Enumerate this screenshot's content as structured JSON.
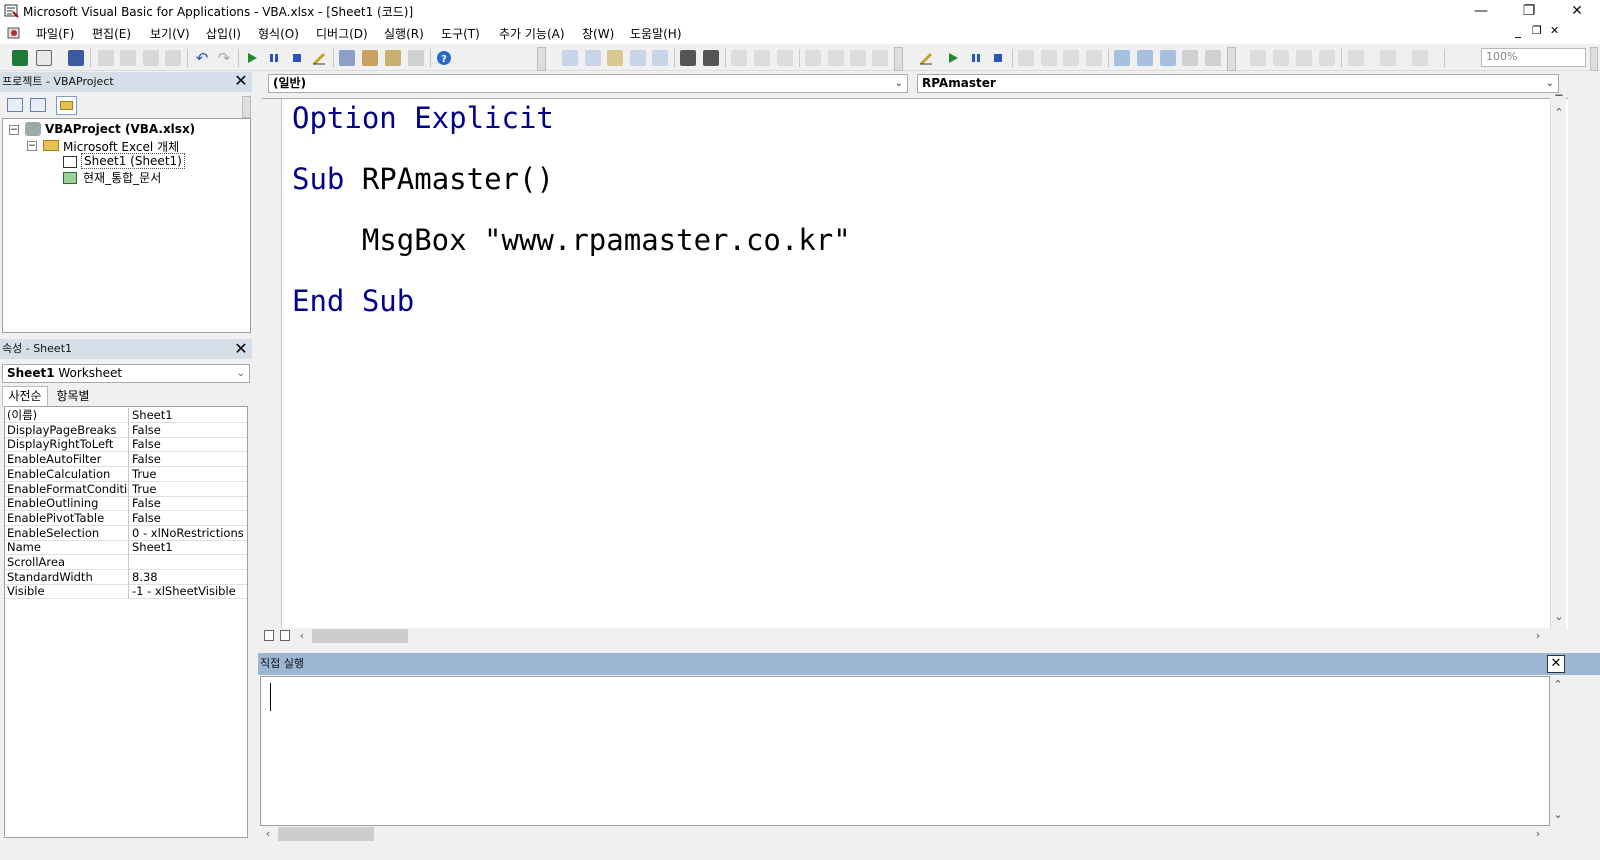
{
  "window": {
    "title": "Microsoft Visual Basic for Applications - VBA.xlsx - [Sheet1 (코드)]",
    "minimize_glyph": "—",
    "restore_glyph": "❐",
    "close_glyph": "✕"
  },
  "menubar": {
    "items": [
      "파일(F)",
      "편집(E)",
      "보기(V)",
      "삽입(I)",
      "형식(O)",
      "디버그(D)",
      "실행(R)",
      "도구(T)",
      "추가 기능(A)",
      "창(W)",
      "도움말(H)"
    ]
  },
  "mdi_controls": [
    "_",
    "❐",
    "✕"
  ],
  "toolbar": {
    "zoom": "100%",
    "icons": [
      "excel-icon",
      "insert-userform-icon",
      "save-icon",
      "cut-icon",
      "copy-icon",
      "paste-icon",
      "find-icon",
      "undo-icon",
      "redo-icon",
      "run-icon",
      "break-icon",
      "reset-icon",
      "design-mode-icon",
      "project-explorer-icon",
      "properties-icon",
      "object-browser-icon",
      "toolbox-icon",
      "help-icon"
    ]
  },
  "project_pane": {
    "title": "프로젝트 - VBAProject",
    "root": "VBAProject (VBA.xlsx)",
    "folder": "Microsoft Excel 개체",
    "items": [
      "Sheet1 (Sheet1)",
      "현재_통합_문서"
    ]
  },
  "properties_pane": {
    "title": "속성 - Sheet1",
    "object_name": "Sheet1",
    "object_type": "Worksheet",
    "tabs": [
      "사전순",
      "항목별"
    ],
    "rows": [
      {
        "k": "(이름)",
        "v": "Sheet1"
      },
      {
        "k": "DisplayPageBreaks",
        "v": "False"
      },
      {
        "k": "DisplayRightToLeft",
        "v": "False"
      },
      {
        "k": "EnableAutoFilter",
        "v": "False"
      },
      {
        "k": "EnableCalculation",
        "v": "True"
      },
      {
        "k": "EnableFormatConditio",
        "v": "True"
      },
      {
        "k": "EnableOutlining",
        "v": "False"
      },
      {
        "k": "EnablePivotTable",
        "v": "False"
      },
      {
        "k": "EnableSelection",
        "v": "0 - xlNoRestrictions"
      },
      {
        "k": "Name",
        "v": "Sheet1"
      },
      {
        "k": "ScrollArea",
        "v": ""
      },
      {
        "k": "StandardWidth",
        "v": "8.38"
      },
      {
        "k": "Visible",
        "v": "-1 - xlSheetVisible"
      }
    ]
  },
  "code_window": {
    "object_combo": "(일반)",
    "procedure_combo": "RPAmaster",
    "lines": [
      {
        "kw": "Option Explicit",
        "text": ""
      },
      {
        "kw": "",
        "text": ""
      },
      {
        "kw": "Sub",
        "text": " RPAmaster()"
      },
      {
        "kw": "",
        "text": ""
      },
      {
        "kw": "",
        "text": "    MsgBox \"www.rpamaster.co.kr\""
      },
      {
        "kw": "",
        "text": ""
      },
      {
        "kw": "End Sub",
        "text": ""
      }
    ]
  },
  "immediate_pane": {
    "title": "직접 실행",
    "content": ""
  },
  "colors": {
    "pane_header": "#d5dfe9",
    "immediate_header": "#9bb7d4",
    "keyword": "#00008b"
  }
}
